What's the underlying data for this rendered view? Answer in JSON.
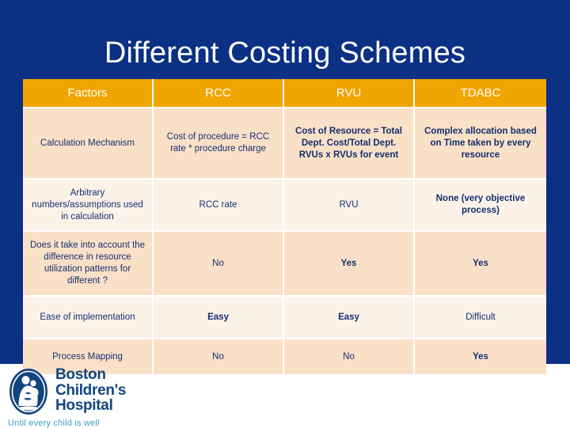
{
  "slide": {
    "title": "Different Costing Schemes",
    "background_color": "#0B3084",
    "title_color": "#FFFFFF"
  },
  "table": {
    "header_bg": "#F0A500",
    "header_text_color": "#FFFFFF",
    "row_bg_a": "#FBE0C8",
    "row_bg_b": "#FDF2E8",
    "body_text_color": "#12306E",
    "positive_text_color": "#0E7A26",
    "columns": [
      "Factors",
      "RCC",
      "RVU",
      "TDABC"
    ],
    "rows": [
      {
        "factor": "Calculation Mechanism",
        "rcc": "Cost of procedure = RCC rate * procedure charge",
        "rvu": "Cost of Resource = Total Dept. Cost/Total Dept. RVUs x RVUs for event",
        "tdabc": "Complex allocation based on Time taken by every resource"
      },
      {
        "factor": "Arbitrary numbers/assumptions used in calculation",
        "rcc": "RCC rate",
        "rvu": "RVU",
        "tdabc": "None (very objective process)"
      },
      {
        "factor": "Does it take into account the difference in resource utilization patterns for different ?",
        "rcc": "No",
        "rvu": "Yes",
        "tdabc": "Yes"
      },
      {
        "factor": "Ease of implementation",
        "rcc": "Easy",
        "rvu": "Easy",
        "tdabc": "Difficult"
      },
      {
        "factor": "Process Mapping",
        "rcc": "No",
        "rvu": "No",
        "tdabc": "Yes"
      }
    ]
  },
  "logo": {
    "line1": "Boston",
    "line2": "Children's",
    "line3": "Hospital",
    "tagline": "Until every child is well",
    "wordmark_color": "#12457F",
    "tagline_color": "#3E9BC9"
  }
}
